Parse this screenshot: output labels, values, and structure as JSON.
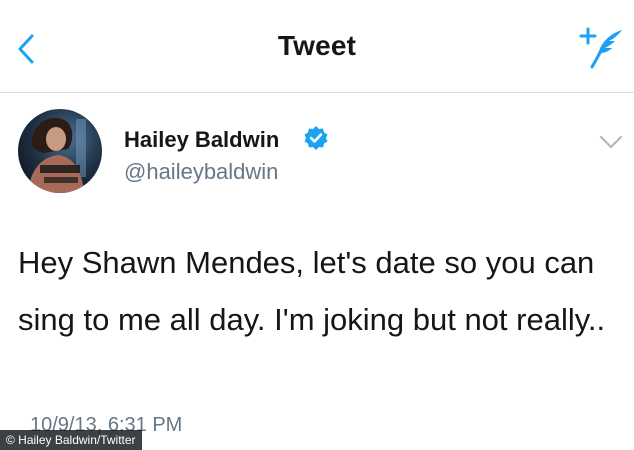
{
  "nav": {
    "title": "Tweet",
    "back_icon": "chevron-left-icon",
    "compose_icon": "compose-quill-icon"
  },
  "tweet": {
    "display_name": "Hailey Baldwin",
    "handle": "@haileybaldwin",
    "verified": true,
    "text": "Hey Shawn Mendes, let's date so you can sing to me all day. I'm joking but not really..",
    "timestamp": "10/9/13, 6:31 PM"
  },
  "credit": "© Hailey Baldwin/Twitter",
  "colors": {
    "accent": "#1da1f2",
    "text": "#14171a",
    "secondary_text": "#657786",
    "divider": "#d8dde1"
  }
}
